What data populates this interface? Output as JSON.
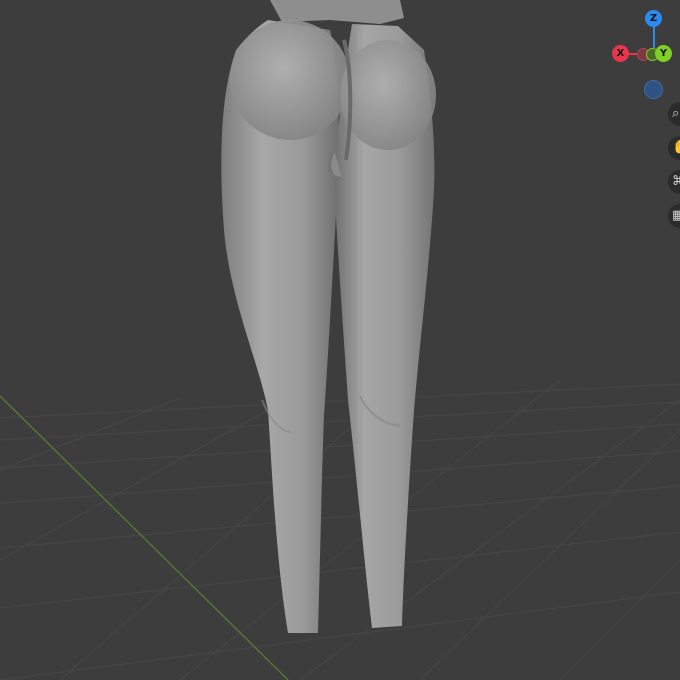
{
  "viewport": {
    "background": "#3d3d3d",
    "grid_color": "#4a4a4a",
    "y_axis_line_color": "#5b7a35"
  },
  "model": {
    "color": "#9c9c9c",
    "description_icon": "mesh-object"
  },
  "gizmo": {
    "x_label": "X",
    "y_label": "Y",
    "z_label": "Z",
    "x_color": "#e8344f",
    "y_color": "#7fcf25",
    "z_color": "#2c8bef"
  },
  "nav": {
    "buttons": [
      {
        "icon": "zoom-icon",
        "glyph": "⌕"
      },
      {
        "icon": "pan-hand-icon",
        "glyph": "✋"
      },
      {
        "icon": "camera-icon",
        "glyph": "⌘"
      },
      {
        "icon": "grid-icon",
        "glyph": "▦"
      }
    ]
  }
}
